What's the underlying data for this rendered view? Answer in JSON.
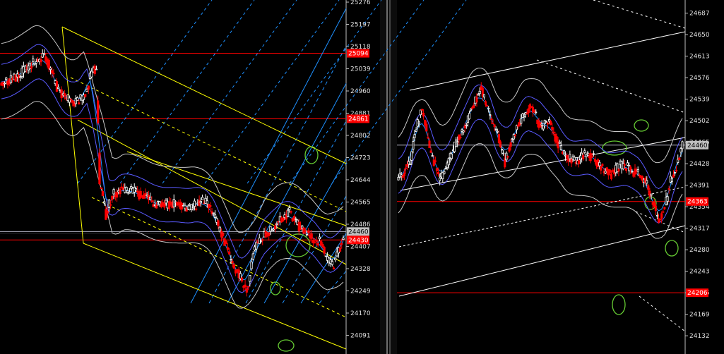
{
  "colors": {
    "background": "#000000",
    "bull_candle": "#ffffff",
    "bear_candle": "#ff0000",
    "resistance_line": "#ff0000",
    "price_line": "#b0b0c0",
    "channel_yellow": "#ffff00",
    "fan_blue": "#1e90ff",
    "bands": "#c8c8c8",
    "ma": "#5a5aff",
    "trendline_white": "#ffffff",
    "marker_green": "#66cc33",
    "axis_text": "#e0e0e0",
    "tag_red": "#ff0000",
    "tag_gray": "#c0c0c0"
  },
  "chart_data": [
    {
      "type": "candlestick",
      "pane": "left",
      "title": "",
      "xlabel": "",
      "ylabel": "",
      "ylim": [
        24052,
        25276
      ],
      "y_ticks": [
        "25276",
        "25197",
        "25118",
        "25039",
        "24960",
        "24881",
        "24802",
        "24723",
        "24644",
        "24565",
        "24486",
        "24407",
        "24328",
        "24249",
        "24170",
        "24091"
      ],
      "price_tags": [
        {
          "value": "25094",
          "style": "red"
        },
        {
          "value": "24861",
          "style": "red"
        },
        {
          "value": "24460",
          "style": "gray"
        },
        {
          "value": "24430",
          "style": "red"
        }
      ],
      "horizontal_lines": [
        25094,
        24861,
        24460,
        24430
      ],
      "price_path": [
        [
          0,
          24990
        ],
        [
          5,
          25010
        ],
        [
          10,
          25060
        ],
        [
          14,
          25080
        ],
        [
          18,
          24960
        ],
        [
          22,
          24920
        ],
        [
          25,
          24930
        ],
        [
          27,
          24960
        ],
        [
          29,
          25050
        ],
        [
          30,
          25020
        ],
        [
          31,
          24640
        ],
        [
          33,
          24520
        ],
        [
          35,
          24590
        ],
        [
          38,
          24610
        ],
        [
          42,
          24600
        ],
        [
          46,
          24580
        ],
        [
          50,
          24550
        ],
        [
          55,
          24560
        ],
        [
          60,
          24545
        ],
        [
          64,
          24570
        ],
        [
          67,
          24520
        ],
        [
          70,
          24440
        ],
        [
          72,
          24370
        ],
        [
          74,
          24330
        ],
        [
          76,
          24285
        ],
        [
          77,
          24250
        ],
        [
          78,
          24270
        ],
        [
          80,
          24400
        ],
        [
          83,
          24450
        ],
        [
          86,
          24470
        ],
        [
          89,
          24510
        ],
        [
          91,
          24530
        ],
        [
          93,
          24490
        ],
        [
          96,
          24460
        ],
        [
          99,
          24430
        ],
        [
          101,
          24420
        ],
        [
          103,
          24360
        ],
        [
          105,
          24340
        ],
        [
          107,
          24400
        ],
        [
          108,
          24455
        ]
      ],
      "series_names": []
    },
    {
      "type": "candlestick",
      "pane": "right",
      "title": "",
      "xlabel": "",
      "ylabel": "",
      "ylim": [
        24114,
        24706
      ],
      "y_ticks": [
        "24687",
        "24650",
        "24613",
        "24576",
        "24539",
        "24502",
        "24465",
        "24428",
        "24391",
        "24354",
        "24317",
        "24280",
        "24243",
        "24206",
        "24169",
        "24132"
      ],
      "price_tags": [
        {
          "value": "24460",
          "style": "gray"
        },
        {
          "value": "24363",
          "style": "red"
        },
        {
          "value": "24206",
          "style": "red"
        }
      ],
      "horizontal_lines": [
        24460,
        24363,
        24206
      ],
      "price_path": [
        [
          0,
          24400
        ],
        [
          4,
          24430
        ],
        [
          6,
          24490
        ],
        [
          8,
          24520
        ],
        [
          11,
          24450
        ],
        [
          14,
          24400
        ],
        [
          17,
          24430
        ],
        [
          20,
          24470
        ],
        [
          23,
          24500
        ],
        [
          26,
          24535
        ],
        [
          28,
          24560
        ],
        [
          30,
          24520
        ],
        [
          33,
          24490
        ],
        [
          36,
          24430
        ],
        [
          39,
          24480
        ],
        [
          42,
          24510
        ],
        [
          45,
          24530
        ],
        [
          48,
          24490
        ],
        [
          51,
          24500
        ],
        [
          54,
          24460
        ],
        [
          57,
          24440
        ],
        [
          60,
          24430
        ],
        [
          63,
          24445
        ],
        [
          66,
          24440
        ],
        [
          69,
          24420
        ],
        [
          72,
          24410
        ],
        [
          75,
          24425
        ],
        [
          78,
          24420
        ],
        [
          81,
          24410
        ],
        [
          84,
          24395
        ],
        [
          86,
          24360
        ],
        [
          88,
          24335
        ],
        [
          90,
          24350
        ],
        [
          92,
          24400
        ],
        [
          94,
          24420
        ],
        [
          96,
          24460
        ]
      ],
      "series_names": []
    }
  ]
}
